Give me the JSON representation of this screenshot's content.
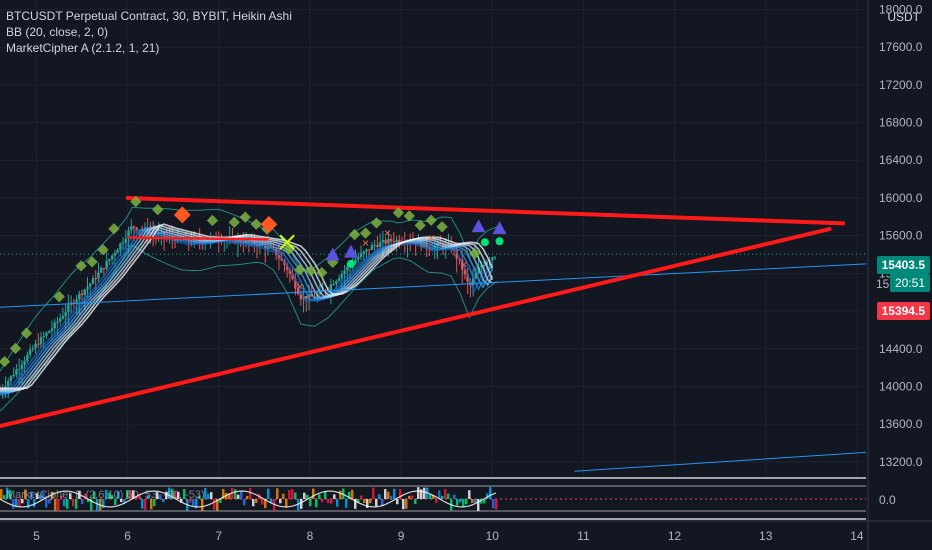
{
  "legend": {
    "symbol": "BTCUSDT Perpetual Contract, 30, BYBIT, Heikin Ashi",
    "bb": "BB (20, close, 2, 0)",
    "mca": "MarketCipher A (2.1.2, 1, 21)",
    "mcb": "MarketCipher B (2.6.10) 60, 53, -60, -53)"
  },
  "axis": {
    "currency": "USDT",
    "osc_zero": "0.0"
  },
  "tags": {
    "last_price": "15403.5",
    "countdown": "20:51",
    "partial": "15",
    "other_price": "15394.5"
  },
  "colors": {
    "background": "#131722",
    "triangle": "#ff1a1a",
    "blue_line": "#2196f3",
    "up": "#26a69a",
    "down": "#ef5350",
    "tag_green": "#00897b",
    "tag_red": "#f23645"
  },
  "chart_data": {
    "type": "candlestick",
    "x_ticks": [
      "5",
      "6",
      "7",
      "8",
      "9",
      "10",
      "11",
      "12",
      "13",
      "14"
    ],
    "y_ticks": [
      13200,
      13600,
      14000,
      14400,
      14800,
      15200,
      15600,
      16000,
      16400,
      16800,
      17200,
      17600,
      18000
    ],
    "y_tick_labels": [
      "13200.0",
      "13600.0",
      "14000.0",
      "14400.0",
      "14800.0",
      "15200.0",
      "15600.0",
      "16000.0",
      "16400.0",
      "16800.0",
      "17200.0",
      "17600.0",
      "18000.0"
    ],
    "ylim": [
      13050,
      18100
    ],
    "xlim": [
      4.6,
      14.1
    ],
    "last_price": 15403.5,
    "triangle": {
      "upper": [
        [
          6.0,
          16000
        ],
        [
          13.85,
          15730
        ]
      ],
      "lower": [
        [
          4.6,
          13580
        ],
        [
          13.7,
          15670
        ]
      ],
      "color": "#ff1a1a"
    },
    "trend_lines": [
      {
        "from": [
          4.6,
          14840
        ],
        "to": [
          14.1,
          15300
        ]
      },
      {
        "from": [
          10.9,
          13100
        ],
        "to": [
          14.1,
          13300
        ]
      }
    ],
    "price_path": [
      [
        4.6,
        13950
      ],
      [
        4.8,
        14200
      ],
      [
        5.0,
        14450
      ],
      [
        5.2,
        14650
      ],
      [
        5.4,
        14900
      ],
      [
        5.6,
        15100
      ],
      [
        5.8,
        15350
      ],
      [
        5.95,
        15550
      ],
      [
        6.05,
        15700
      ],
      [
        6.2,
        15650
      ],
      [
        6.4,
        15600
      ],
      [
        6.6,
        15550
      ],
      [
        6.8,
        15550
      ],
      [
        7.0,
        15580
      ],
      [
        7.2,
        15550
      ],
      [
        7.4,
        15520
      ],
      [
        7.6,
        15450
      ],
      [
        7.75,
        15250
      ],
      [
        7.9,
        14950
      ],
      [
        8.05,
        14950
      ],
      [
        8.2,
        15050
      ],
      [
        8.35,
        15200
      ],
      [
        8.5,
        15350
      ],
      [
        8.7,
        15500
      ],
      [
        8.9,
        15550
      ],
      [
        9.1,
        15550
      ],
      [
        9.3,
        15480
      ],
      [
        9.45,
        15500
      ],
      [
        9.55,
        15480
      ],
      [
        9.65,
        15300
      ],
      [
        9.75,
        15050
      ],
      [
        9.85,
        15250
      ],
      [
        9.95,
        15350
      ],
      [
        10.05,
        15403
      ]
    ]
  }
}
